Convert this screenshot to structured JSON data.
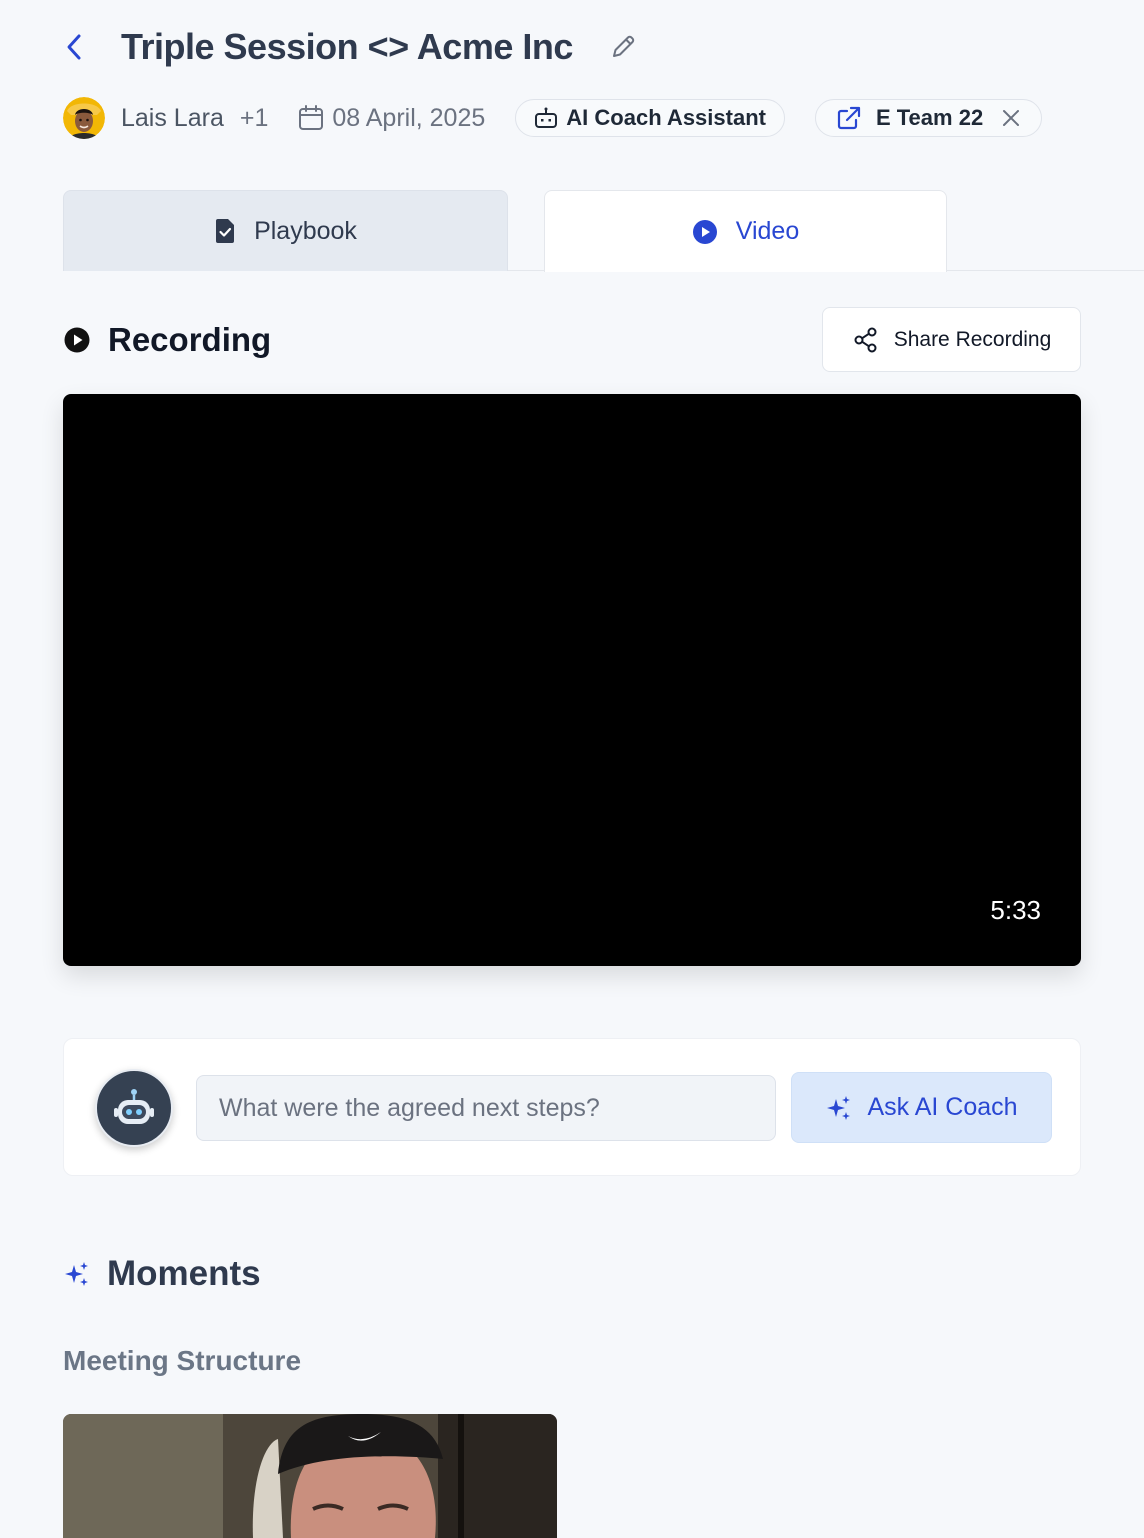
{
  "header": {
    "title": "Triple Session <> Acme Inc"
  },
  "meta": {
    "owner": "Lais Lara",
    "extra_participants": "+1",
    "date": "08 April, 2025",
    "coach_chip": "AI Coach Assistant",
    "team_chip": "E Team 22"
  },
  "tabs": [
    {
      "label": "Playbook",
      "active": false
    },
    {
      "label": "Video",
      "active": true
    }
  ],
  "recording": {
    "title": "Recording",
    "share_label": "Share Recording",
    "duration": "5:33"
  },
  "ask": {
    "placeholder": "What were the agreed next steps?",
    "button_label": "Ask AI Coach"
  },
  "moments": {
    "title": "Moments",
    "section": "Meeting Structure"
  },
  "colors": {
    "accent": "#2947d2",
    "title": "#2f3a4e",
    "ask_button_bg": "#dbe8fb"
  },
  "icons": [
    "chevron-left-icon",
    "pencil-icon",
    "calendar-icon",
    "robot-icon",
    "external-link-icon",
    "close-icon",
    "document-check-icon",
    "play-circle-icon",
    "share-icon",
    "sparkles-icon"
  ]
}
